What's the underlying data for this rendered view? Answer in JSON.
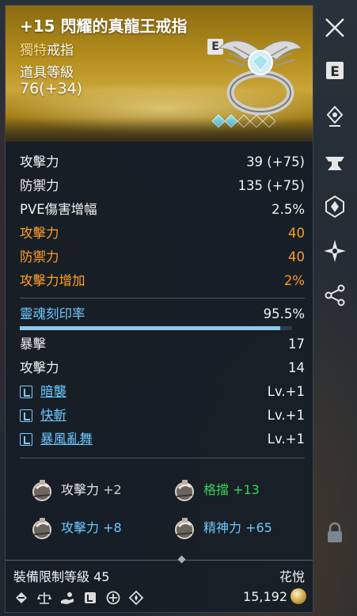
{
  "item": {
    "title": "+15 閃耀的真龍王戒指",
    "rarity_prefix": "獨特",
    "rarity_suffix": "戒指",
    "level_label": "道具等級",
    "level_value": "76(+34)",
    "engrave_badge": "E",
    "gems_total": 5,
    "gems_filled": 2
  },
  "stats": [
    {
      "label": "攻擊力",
      "value": "39 (+75)",
      "color": "#f2f2f2"
    },
    {
      "label": "防禦力",
      "value": "135 (+75)",
      "color": "#f2f2f2"
    },
    {
      "label": "PVE傷害增幅",
      "value": "2.5%",
      "color": "#f2f2f2"
    },
    {
      "label": "攻擊力",
      "value": "40",
      "color": "#ff9d2a"
    },
    {
      "label": "防禦力",
      "value": "40",
      "color": "#ff9d2a"
    },
    {
      "label": "攻擊力增加",
      "value": "2%",
      "color": "#ff9d2a"
    }
  ],
  "soul": {
    "label": "靈魂刻印率",
    "value": "95.5%",
    "fill": 0.955
  },
  "soul_stats": [
    {
      "label": "暴擊",
      "value": "17"
    },
    {
      "label": "攻擊力",
      "value": "14"
    }
  ],
  "skills": [
    {
      "name": "暗襲",
      "value": "Lv.+1"
    },
    {
      "name": "快斬",
      "value": "Lv.+1"
    },
    {
      "name": "暴風亂舞",
      "value": "Lv.+1"
    }
  ],
  "substats": [
    {
      "stat": "攻擊力",
      "value": "+2",
      "color": "#cfcfcf"
    },
    {
      "stat": "格擋",
      "value": "+13",
      "color": "#35d35a"
    },
    {
      "stat": "攻擊力",
      "value": "+8",
      "color": "#6cc9ff"
    },
    {
      "stat": "精神力",
      "value": "+65",
      "color": "#6cc9ff"
    }
  ],
  "footer": {
    "requirement": "裝備限制等級 45",
    "maker": "花悅",
    "price": "15,192"
  },
  "side_icons": [
    "close-icon",
    "engrave-e-icon",
    "pin-location-icon",
    "anvil-icon",
    "crystal-shield-icon",
    "sparkle-icon",
    "share-icon",
    "lock-icon"
  ],
  "footer_icons": [
    "trade-icon",
    "scale-icon",
    "hand-icon",
    "gem-socket-icon",
    "plus-circle-icon",
    "diamond-star-icon"
  ]
}
